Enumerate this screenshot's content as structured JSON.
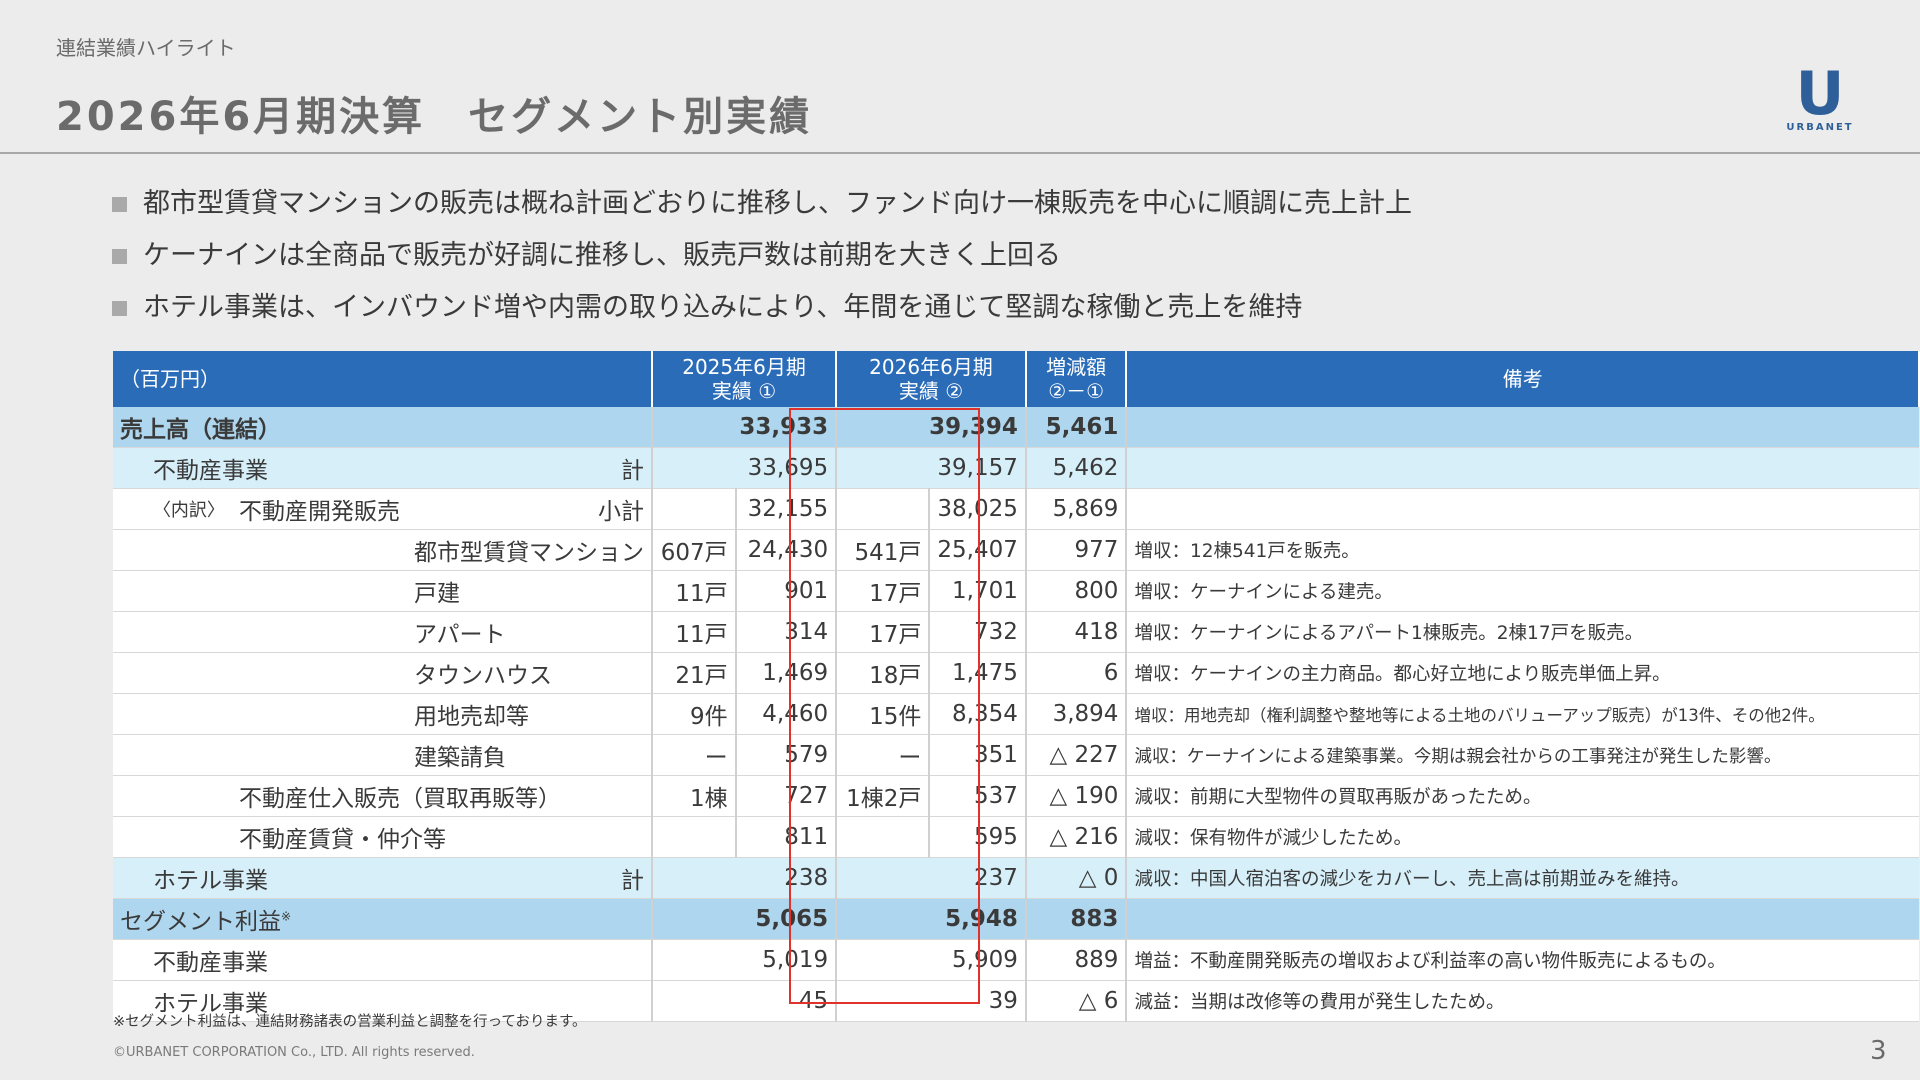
{
  "header": {
    "breadcrumb": "連結業績ハイライト",
    "title": "2026年6月期決算　セグメント別実績",
    "logo_text": "URBANET",
    "logo_mark": "U"
  },
  "bullets": [
    "都市型賃貸マンションの販売は概ね計画どおりに推移し、ファンド向け一棟販売を中心に順調に売上計上",
    "ケーナインは全商品で販売が好調に推移し、販売戸数は前期を大きく上回る",
    "ホテル事業は、インバウンド増や内需の取り込みにより、年間を通じて堅調な稼働と売上を維持"
  ],
  "table": {
    "unit": "（百万円）",
    "col_prev": [
      "2025年6月期",
      "実績 ①"
    ],
    "col_curr": [
      "2026年6月期",
      "実績 ②"
    ],
    "col_diff": [
      "増減額",
      "②－①"
    ],
    "col_note": "備考",
    "rows": {
      "sales_total": {
        "label": "売上高（連結）",
        "prev": "33,933",
        "curr": "39,394",
        "diff": "5,461"
      },
      "re_total": {
        "label": "不動産事業",
        "tag": "計",
        "prev": "33,695",
        "curr": "39,157",
        "diff": "5,462"
      },
      "dev": {
        "prefix": "〈内訳〉",
        "label": "不動産開発販売",
        "tag": "小計",
        "prev": "32,155",
        "curr": "38,025",
        "diff": "5,869"
      },
      "mansion": {
        "label": "都市型賃貸マンション",
        "prev_cnt": "607戸",
        "prev": "24,430",
        "curr_cnt": "541戸",
        "curr": "25,407",
        "diff": "977",
        "note": "増収：12棟541戸を販売。"
      },
      "house": {
        "label": "戸建",
        "prev_cnt": "11戸",
        "prev": "901",
        "curr_cnt": "17戸",
        "curr": "1,701",
        "diff": "800",
        "note": "増収：ケーナインによる建売。"
      },
      "apart": {
        "label": "アパート",
        "prev_cnt": "11戸",
        "prev": "314",
        "curr_cnt": "17戸",
        "curr": "732",
        "diff": "418",
        "note": "増収：ケーナインによるアパート1棟販売。2棟17戸を販売。"
      },
      "town": {
        "label": "タウンハウス",
        "prev_cnt": "21戸",
        "prev": "1,469",
        "curr_cnt": "18戸",
        "curr": "1,475",
        "diff": "6",
        "note": "増収：ケーナインの主力商品。都心好立地により販売単価上昇。"
      },
      "land": {
        "label": "用地売却等",
        "prev_cnt": "9件",
        "prev": "4,460",
        "curr_cnt": "15件",
        "curr": "8,354",
        "diff": "3,894",
        "note": "増収：用地売却（権利調整や整地等による土地のバリューアップ販売）が13件、その他2件。"
      },
      "build": {
        "label": "建築請負",
        "prev_cnt": "ー",
        "prev": "579",
        "curr_cnt": "ー",
        "curr": "351",
        "diff": "△ 227",
        "note": "減収：ケーナインによる建築事業。今期は親会社からの工事発注が発生した影響。"
      },
      "purchase": {
        "label": "不動産仕入販売（買取再販等）",
        "prev_cnt": "1棟",
        "prev": "727",
        "curr_cnt": "1棟2戸",
        "curr": "537",
        "diff": "△ 190",
        "note": "減収：前期に大型物件の買取再販があったため。"
      },
      "lease": {
        "label": "不動産賃貸・仲介等",
        "prev": "811",
        "curr": "595",
        "diff": "△ 216",
        "note": "減収：保有物件が減少したため。"
      },
      "hotel_total": {
        "label": "ホテル事業",
        "tag": "計",
        "prev": "238",
        "curr": "237",
        "diff": "△ 0",
        "note": "減収：中国人宿泊客の減少をカバーし、売上高は前期並みを維持。"
      },
      "profit_total": {
        "label": "セグメント利益",
        "mark": "※",
        "prev": "5,065",
        "curr": "5,948",
        "diff": "883"
      },
      "profit_re": {
        "label": "不動産事業",
        "prev": "5,019",
        "curr": "5,909",
        "diff": "889",
        "note": "増益：不動産開発販売の増収および利益率の高い物件販売によるもの。"
      },
      "profit_hotel": {
        "label": "ホテル事業",
        "prev": "45",
        "curr": "39",
        "diff": "△ 6",
        "note": "減益：当期は改修等の費用が発生したため。"
      }
    }
  },
  "footnote": "※セグメント利益は、連結財務諸表の営業利益と調整を行っております。",
  "copyright": "©URBANET CORPORATION Co., LTD. All rights reserved.",
  "page_number": "3",
  "colors": {
    "header_blue": "#2a6cb8",
    "total_row": "#aed6ee",
    "sub_row": "#d6eff9",
    "highlight_red": "#e0312b"
  }
}
